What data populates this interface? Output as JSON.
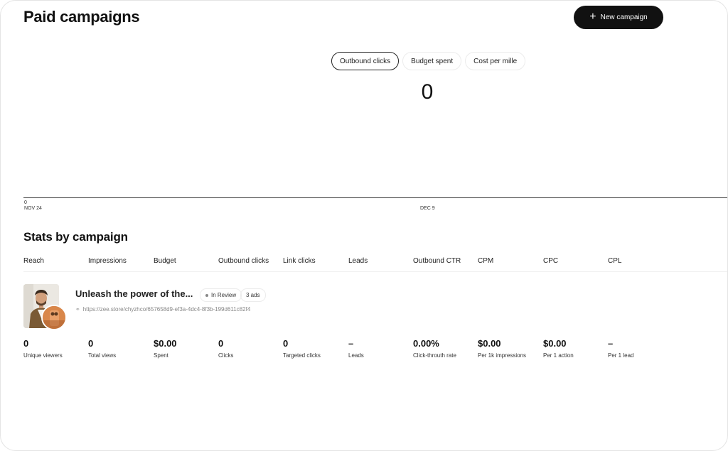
{
  "header": {
    "title": "Paid campaigns",
    "new_campaign_label": "New campaign"
  },
  "tabs": [
    {
      "label": "Outbound clicks",
      "active": true
    },
    {
      "label": "Budget spent",
      "active": false
    },
    {
      "label": "Cost per mille",
      "active": false
    }
  ],
  "metric_value": "0",
  "chart": {
    "y_zero": "0",
    "x_ticks": [
      "NOV 24",
      "DEC 9"
    ]
  },
  "stats": {
    "title": "Stats by campaign",
    "columns": [
      "Reach",
      "Impressions",
      "Budget",
      "Outbound clicks",
      "Link clicks",
      "Leads",
      "Outbound CTR",
      "CPM",
      "CPC",
      "CPL"
    ]
  },
  "campaign": {
    "name": "Unleash the power of the...",
    "status": "In Review",
    "ads_count": "3 ads",
    "link": "https://zee.store/chyzhco/657658d9-ef3a-4dc4-8f3b-199d611c82f4",
    "values": [
      {
        "value": "0",
        "label": "Unique viewers"
      },
      {
        "value": "0",
        "label": "Total views"
      },
      {
        "value": "$0.00",
        "label": "Spent"
      },
      {
        "value": "0",
        "label": "Clicks"
      },
      {
        "value": "0",
        "label": "Targeted clicks"
      },
      {
        "value": "–",
        "label": "Leads"
      },
      {
        "value": "0.00%",
        "label": "Click-throuth rate"
      },
      {
        "value": "$0.00",
        "label": "Per 1k impressions"
      },
      {
        "value": "$0.00",
        "label": "Per 1 action"
      },
      {
        "value": "–",
        "label": "Per 1 lead"
      }
    ]
  },
  "colors": {
    "accent": "#111111",
    "border": "#ececec"
  }
}
